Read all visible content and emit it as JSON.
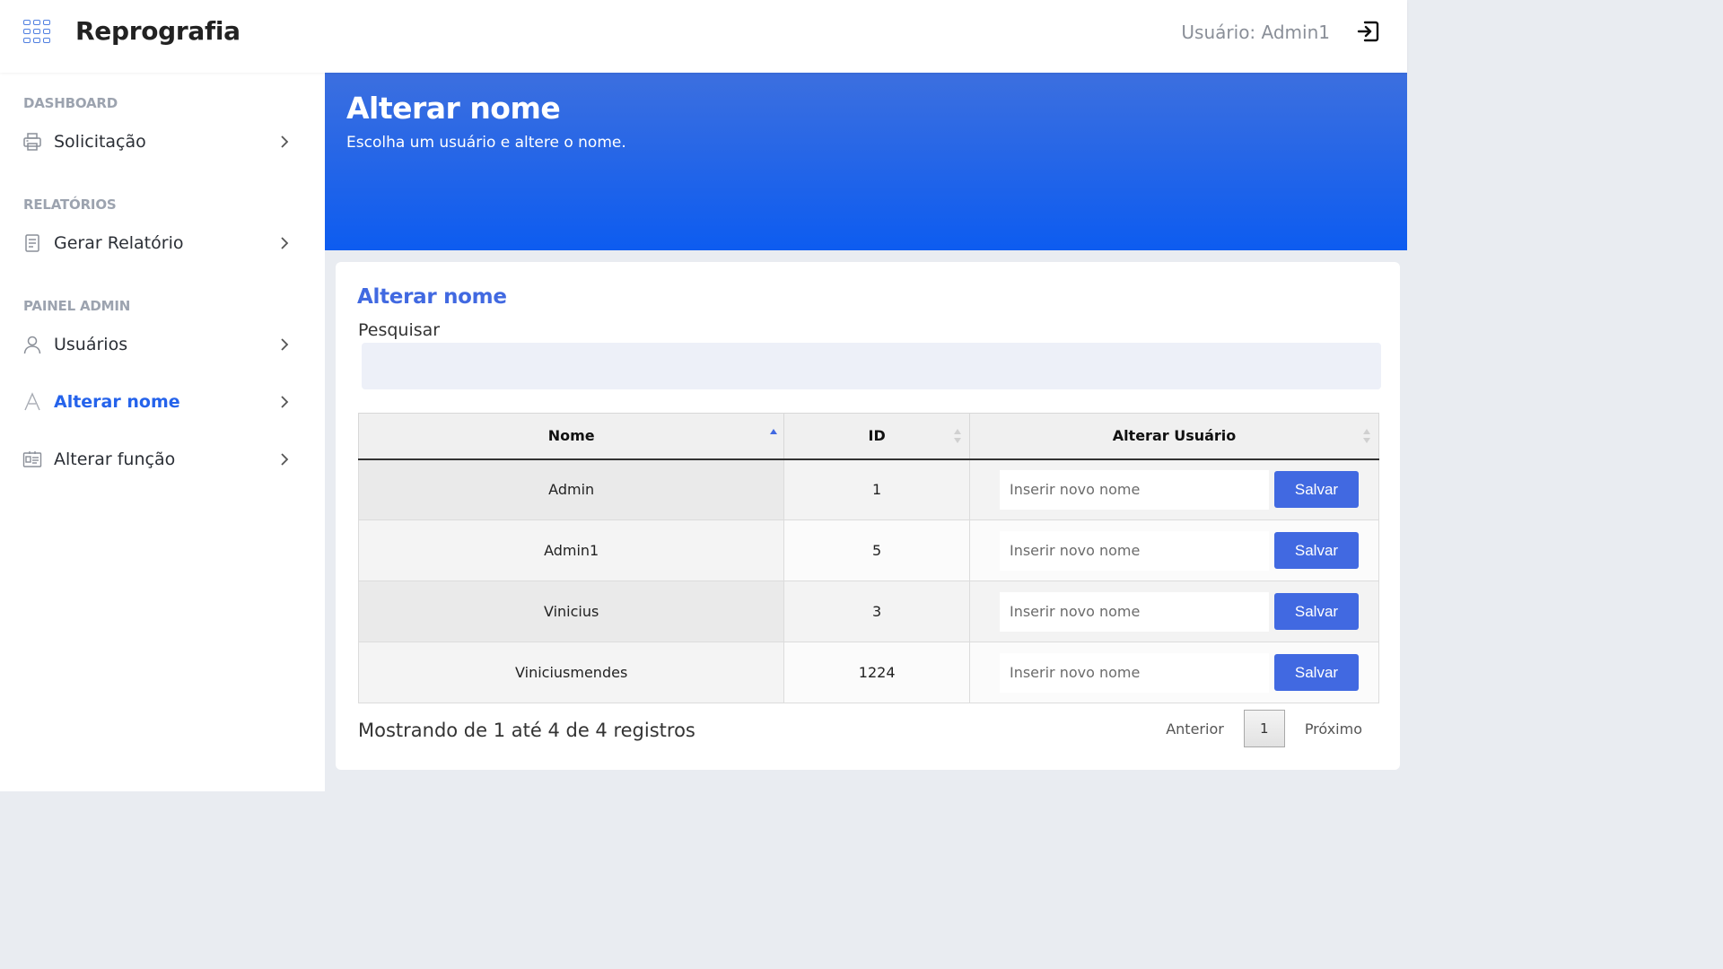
{
  "app": {
    "title": "Reprografia",
    "user_label": "Usuário: Admin1"
  },
  "sidebar": {
    "sections": [
      {
        "title": "DASHBOARD",
        "items": [
          {
            "label": "Solicitação",
            "icon": "printer-icon"
          }
        ]
      },
      {
        "title": "RELATÓRIOS",
        "items": [
          {
            "label": "Gerar Relatório",
            "icon": "report-icon"
          }
        ]
      },
      {
        "title": "PAINEL ADMIN",
        "items": [
          {
            "label": "Usuários",
            "icon": "user-icon"
          },
          {
            "label": "Alterar nome",
            "icon": "letter-a-icon",
            "active": true
          },
          {
            "label": "Alterar função",
            "icon": "id-card-icon"
          }
        ]
      }
    ]
  },
  "header": {
    "title": "Alterar nome",
    "subtitle": "Escolha um usuário e altere o nome."
  },
  "card": {
    "title": "Alterar nome",
    "search_label": "Pesquisar",
    "search_value": "",
    "columns": [
      "Nome",
      "ID",
      "Alterar Usuário"
    ],
    "rows": [
      {
        "name": "Admin",
        "id": "1"
      },
      {
        "name": "Admin1",
        "id": "5"
      },
      {
        "name": "Vinicius",
        "id": "3"
      },
      {
        "name": "Viniciusmendes",
        "id": "1224"
      }
    ],
    "input_placeholder": "Inserir novo nome",
    "save_label": "Salvar",
    "info": "Mostrando de 1 até 4 de 4 registros",
    "pagination": {
      "prev": "Anterior",
      "page": "1",
      "next": "Próximo"
    }
  },
  "colors": {
    "accent": "#4169e1",
    "active_nav": "#2563eb",
    "banner_top": "#3c6fdf",
    "banner_bottom": "#0d5cf0"
  }
}
